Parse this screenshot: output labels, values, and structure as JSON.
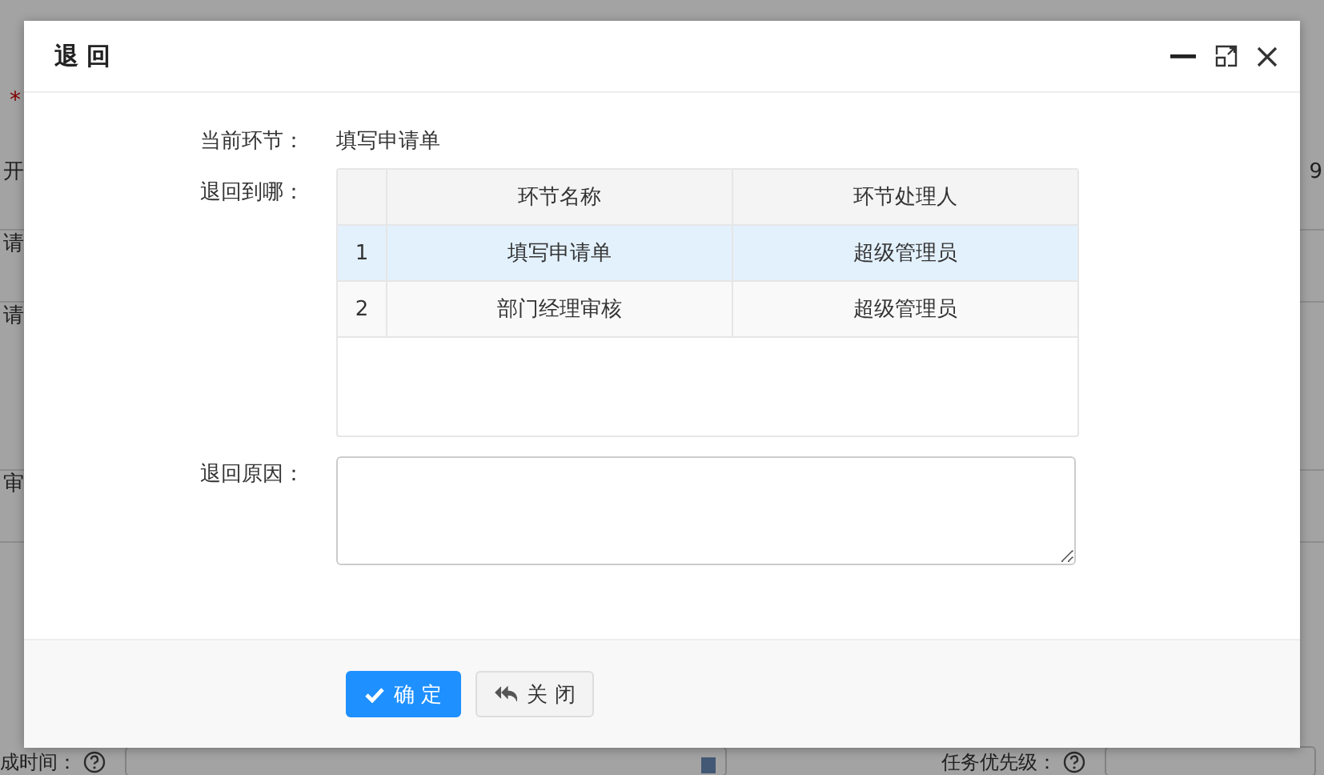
{
  "background_form": {
    "required_mark": "*",
    "rows": [
      {
        "label": "开",
        "value": "9"
      },
      {
        "label": "请"
      },
      {
        "label": "请"
      },
      {
        "label": "审"
      }
    ],
    "bottom_fields": [
      {
        "label": "成时间：",
        "kind": "date"
      },
      {
        "label": "任务优先级：",
        "kind": "select"
      }
    ]
  },
  "dialog": {
    "title": "退 回",
    "current_step": {
      "label": "当前环节：",
      "value": "填写申请单"
    },
    "return_to": {
      "label": "退回到哪：",
      "table": {
        "columns": [
          "环节名称",
          "环节处理人"
        ],
        "rows": [
          {
            "index": "1",
            "step": "填写申请单",
            "handler": "超级管理员",
            "selected": true
          },
          {
            "index": "2",
            "step": "部门经理审核",
            "handler": "超级管理员",
            "selected": false
          }
        ]
      }
    },
    "reason": {
      "label": "退回原因："
    },
    "buttons": [
      {
        "label": "确 定",
        "kind": "primary"
      },
      {
        "label": "关 闭",
        "kind": "default"
      }
    ]
  }
}
